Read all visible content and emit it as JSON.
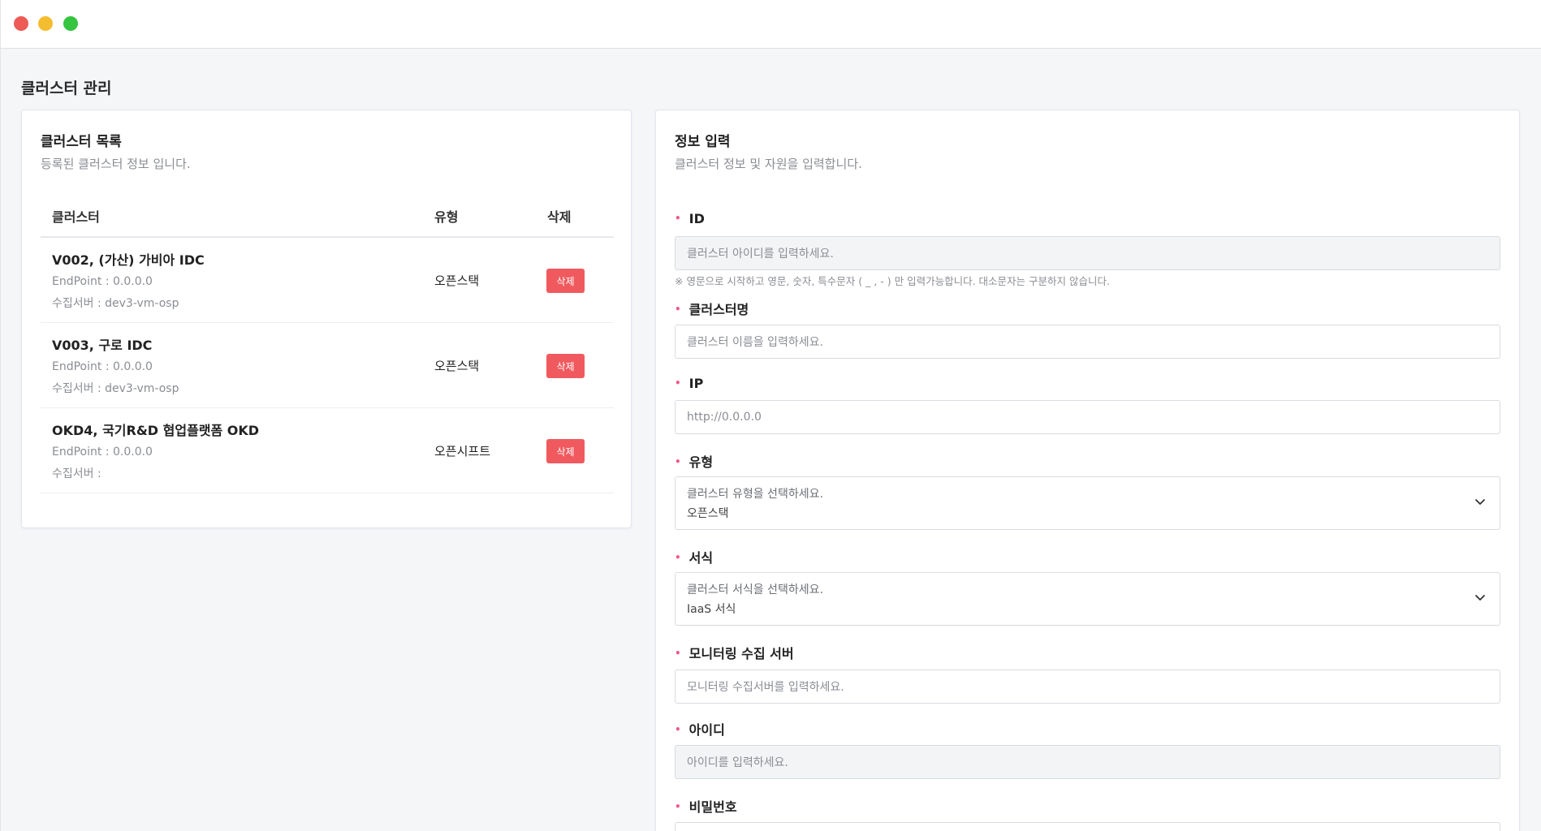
{
  "window": {
    "controls": [
      "close",
      "minimize",
      "maximize"
    ]
  },
  "page": {
    "title": "클러스터 관리"
  },
  "list": {
    "title": "클러스터 목록",
    "subtitle": "등록된 클러스터 정보 입니다.",
    "columns": {
      "cluster": "클러스터",
      "type": "유형",
      "delete": "삭제"
    },
    "rows": [
      {
        "name": "V002, (가산) 가비아 IDC",
        "endpoint": "EndPoint : 0.0.0.0",
        "server": "수집서버 : dev3-vm-osp",
        "type": "오픈스택",
        "delete_label": "삭제"
      },
      {
        "name": "V003, 구로 IDC",
        "endpoint": "EndPoint : 0.0.0.0",
        "server": "수집서버 : dev3-vm-osp",
        "type": "오픈스택",
        "delete_label": "삭제"
      },
      {
        "name": "OKD4, 국기R&D 협업플랫폼 OKD",
        "endpoint": "EndPoint : 0.0.0.0",
        "server": "수집서버 :",
        "type": "오픈시프트",
        "delete_label": "삭제"
      }
    ]
  },
  "form": {
    "title": "정보 입력",
    "subtitle": "클러스터 정보 및 자원을 입력합니다.",
    "required_mark": "•",
    "fields": {
      "id": {
        "label": "ID",
        "placeholder": "클러스터 아이디를 입력하세요.",
        "helper": "※ 영문으로 시작하고 영문, 숫자, 특수문자 ( _ , - ) 만 입력가능합니다. 대소문자는 구분하지 않습니다."
      },
      "name": {
        "label": "클러스터명",
        "placeholder": "클러스터 이름을 입력하세요."
      },
      "ip": {
        "label": "IP",
        "placeholder": "http://0.0.0.0"
      },
      "type": {
        "label": "유형",
        "placeholder": "클러스터 유형을 선택하세요.",
        "value": "오픈스택"
      },
      "format": {
        "label": "서식",
        "placeholder": "클러스터 서식을 선택하세요.",
        "value": "IaaS 서식"
      },
      "monitor": {
        "label": "모니터링 수집 서버",
        "placeholder": "모니터링 수집서버를 입력하세요."
      },
      "userid": {
        "label": "아이디",
        "placeholder": "아이디를 입력하세요."
      },
      "password": {
        "label": "비밀번호"
      }
    }
  },
  "colors": {
    "delete_button": "#f05a5f",
    "required": "#f05a8c",
    "background": "#f5f6f8"
  },
  "icons": {
    "select_arrow": "chevron-down-icon"
  }
}
